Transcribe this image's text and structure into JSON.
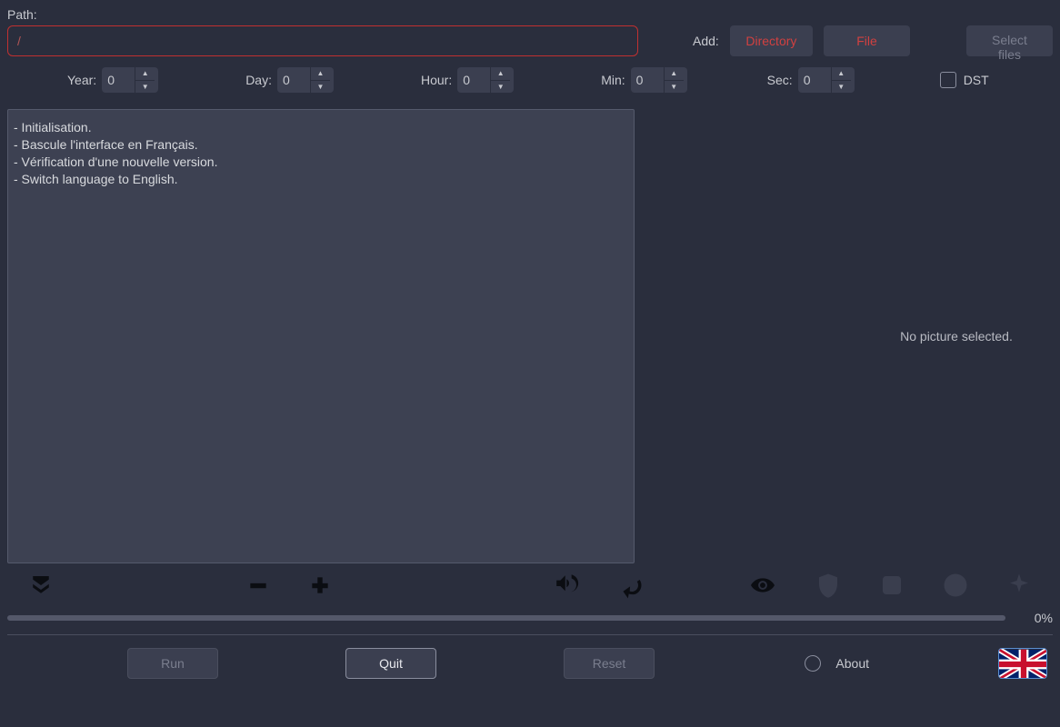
{
  "path": {
    "label": "Path:",
    "value": "/"
  },
  "add": {
    "label": "Add:",
    "directory": "Directory",
    "file": "File",
    "select_files": "Select files"
  },
  "offsets": {
    "year_label": "Year:",
    "year_value": "0",
    "day_label": "Day:",
    "day_value": "0",
    "hour_label": "Hour:",
    "hour_value": "0",
    "min_label": "Min:",
    "min_value": "0",
    "sec_label": "Sec:",
    "sec_value": "0",
    "dst_label": "DST"
  },
  "log": [
    "- Initialisation.",
    "- Bascule l'interface en Français.",
    "- Vérification d'une nouvelle version.",
    "- Switch language to English."
  ],
  "preview": {
    "empty_text": "No picture selected."
  },
  "progress": {
    "percent": "0%"
  },
  "actions": {
    "run": "Run",
    "quit": "Quit",
    "reset": "Reset",
    "about": "About"
  },
  "icons": {
    "download": "download-icon",
    "minus": "minus-icon",
    "plus": "plus-icon",
    "volume": "volume-icon",
    "rotate": "rotate-icon",
    "eye": "eye-icon",
    "shield": "shield-icon",
    "stop": "stop-icon",
    "help": "help-icon",
    "sparkle": "sparkle-icon",
    "flag": "uk-flag"
  }
}
